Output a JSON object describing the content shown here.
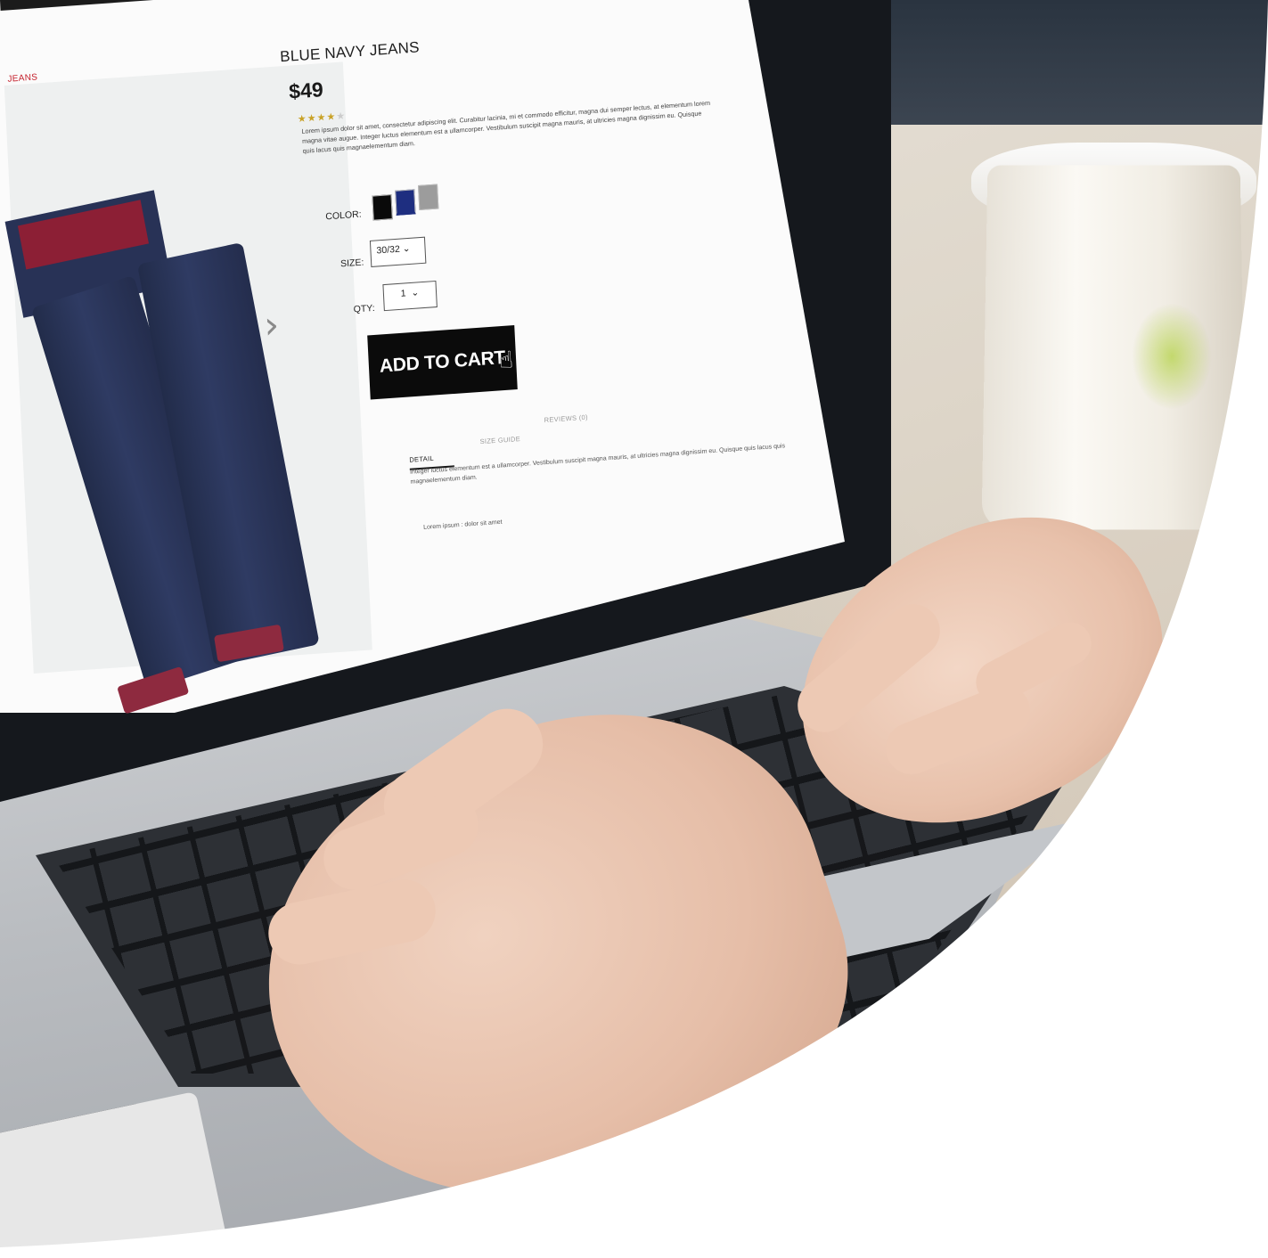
{
  "scene": "person typing on a laptop showing an online clothing store product page",
  "store_page": {
    "breadcrumb": "JEANS",
    "product": {
      "title": "BLUE NAVY JEANS",
      "price": "$49",
      "rating": 4,
      "rating_max": 5,
      "description": "Lorem ipsum dolor sit amet, consectetur adipiscing elit. Curabitur lacinia, mi et commodo efficitur, magna dui semper lectus, at elementum lorem magna vitae augue. Integer luctus elementum est a ullamcorper. Vestibulum suscipit magna mauris, at ultricies magna dignissim eu. Quisque quis lacus quis magnaelementum diam."
    },
    "options": {
      "color_label": "COLOR:",
      "colors": [
        "#0a0a0a",
        "#1e2e80",
        "#9c9c9c"
      ],
      "selected_color": "#1e2e80",
      "size_label": "SIZE:",
      "size_value": "30/32",
      "qty_label": "QTY:",
      "qty_value": "1"
    },
    "add_to_cart_label": "ADD TO CART",
    "tabs": [
      {
        "label": "DETAIL",
        "active": true
      },
      {
        "label": "SIZE GUIDE",
        "active": false
      },
      {
        "label": "REVIEWS (0)",
        "active": false
      }
    ],
    "detail_text": "Integer luctus elementum est a ullamcorper. Vestibulum suscipit magna mauris, at ultricies magna dignissim eu. Quisque quis lacus quis magnaelementum diam.",
    "detail_note": "Lorem ipsum : dolor sit amet"
  },
  "icons": {
    "next": "chevron-right-icon",
    "cursor": "hand-pointer-icon",
    "dropdown": "chevron-down-icon"
  }
}
